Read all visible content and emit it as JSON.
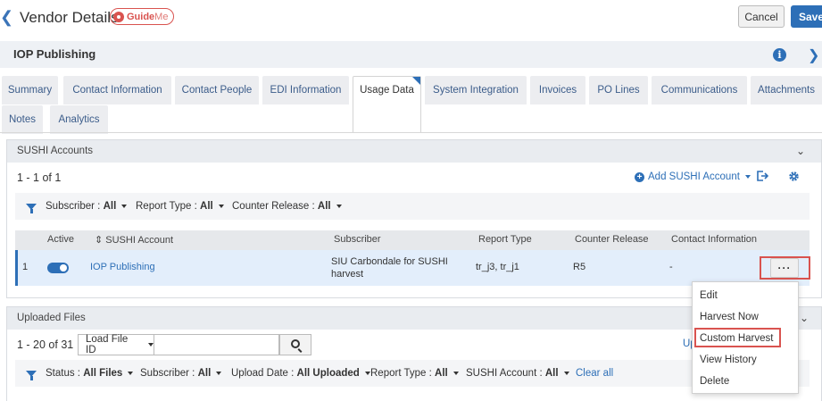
{
  "header": {
    "title": "Vendor Details",
    "guide_me_main": "Guide",
    "guide_me_suffix": "Me",
    "cancel_label": "Cancel",
    "save_label": "Save"
  },
  "vendor": {
    "name": "IOP Publishing"
  },
  "tabs": [
    {
      "label": "Summary"
    },
    {
      "label": "Contact Information"
    },
    {
      "label": "Contact People"
    },
    {
      "label": "EDI Information"
    },
    {
      "label": "Usage Data"
    },
    {
      "label": "System Integration"
    },
    {
      "label": "Invoices"
    },
    {
      "label": "PO Lines"
    },
    {
      "label": "Communications"
    },
    {
      "label": "Attachments"
    },
    {
      "label": "Notes"
    },
    {
      "label": "Analytics"
    }
  ],
  "active_tab": "Usage Data",
  "sushi": {
    "title": "SUSHI Accounts",
    "count": "1 - 1 of 1",
    "add_label": "Add SUSHI Account",
    "filters": [
      {
        "label": "Subscriber :",
        "value": "All"
      },
      {
        "label": "Report Type :",
        "value": "All"
      },
      {
        "label": "Counter Release :",
        "value": "All"
      }
    ],
    "columns": [
      "Active",
      "SUSHI Account",
      "Subscriber",
      "Report Type",
      "Counter Release",
      "Contact Information"
    ],
    "rows": [
      {
        "num": "1",
        "active": true,
        "account": "IOP Publishing",
        "subscriber_line1": "SIU Carbondale for SUSHI",
        "subscriber_line2": "harvest",
        "report_type": "tr_j3, tr_j1",
        "counter_release": "R5",
        "contact": "-",
        "actions_label": "···"
      }
    ]
  },
  "row_menu": {
    "items": [
      "Edit",
      "Harvest Now",
      "Custom Harvest",
      "View History",
      "Delete"
    ],
    "highlighted": "Custom Harvest"
  },
  "uploaded": {
    "title": "Uploaded Files",
    "count": "1 - 20 of 31",
    "search_field": "Load File ID",
    "search_value": "",
    "partial_link": "Up",
    "filters": [
      {
        "label": "Status :",
        "value": "All Files"
      },
      {
        "label": "Subscriber :",
        "value": "All"
      },
      {
        "label": "Upload Date :",
        "value": "All Uploaded"
      },
      {
        "label": "Report Type :",
        "value": "All"
      },
      {
        "label": "SUSHI Account :",
        "value": "All"
      }
    ],
    "clear_all": "Clear all"
  },
  "colors": {
    "accent": "#2d6fb7",
    "highlight_border": "#d9534f",
    "tab_bg": "#ecedf0"
  }
}
